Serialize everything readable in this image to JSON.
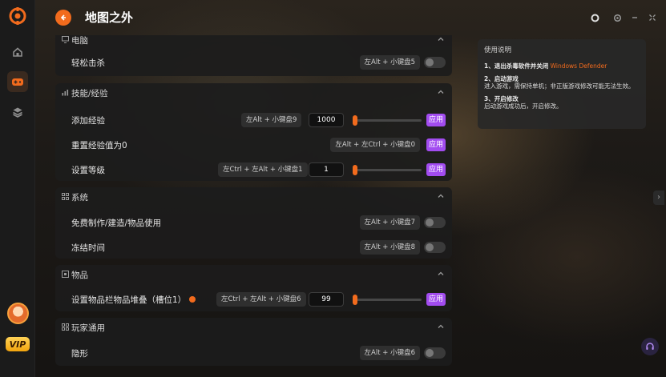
{
  "app": {
    "title": "地图之外"
  },
  "sections": [
    {
      "title": "电脑",
      "icon": "pc-icon",
      "rows": [
        {
          "label": "轻松击杀",
          "hotkey": "左Alt + 小键盘5",
          "control": "toggle"
        }
      ]
    },
    {
      "title": "技能/经验",
      "icon": "bar-chart-icon",
      "rows": [
        {
          "label": "添加经验",
          "hotkey": "左Alt + 小键盘9",
          "control": "number-slider",
          "value": "1000",
          "apply": "应用"
        },
        {
          "label": "重置经验值为0",
          "hotkey": "左Alt + 左Ctrl + 小键盘0",
          "control": "apply",
          "apply": "应用"
        },
        {
          "label": "设置等级",
          "hotkey": "左Ctrl + 左Alt + 小键盘1",
          "control": "number-slider",
          "value": "1",
          "apply": "应用"
        }
      ]
    },
    {
      "title": "系统",
      "icon": "grid-icon",
      "rows": [
        {
          "label": "免费制作/建造/物品使用",
          "hotkey": "左Alt + 小键盘7",
          "control": "toggle"
        },
        {
          "label": "冻结时间",
          "hotkey": "左Alt + 小键盘8",
          "control": "toggle"
        }
      ]
    },
    {
      "title": "物品",
      "icon": "box-icon",
      "rows": [
        {
          "label": "设置物品栏物品堆叠（槽位1）",
          "hotkey": "左Ctrl + 左Alt + 小键盘6",
          "control": "number-slider",
          "value": "99",
          "apply": "应用"
        }
      ]
    },
    {
      "title": "玩家通用",
      "icon": "grid-icon",
      "rows": [
        {
          "label": "隐形",
          "hotkey": "左Alt + 小键盘6",
          "control": "toggle"
        }
      ]
    }
  ],
  "help": {
    "title": "使用说明",
    "steps": [
      {
        "heading": "1、退出杀毒软件并关闭",
        "highlight": "Windows Defender",
        "body": ""
      },
      {
        "heading": "2、启动游戏",
        "highlight": "",
        "body": "进入游戏，需保持单机；非正版游戏修改可能无法生效。"
      },
      {
        "heading": "3、开启修改",
        "highlight": "",
        "body": "启动游戏成功后，开启修改。"
      }
    ]
  },
  "rail": {
    "vip": "VIP"
  },
  "colors": {
    "accent": "#f26b1d",
    "apply": "#a24cf0"
  }
}
